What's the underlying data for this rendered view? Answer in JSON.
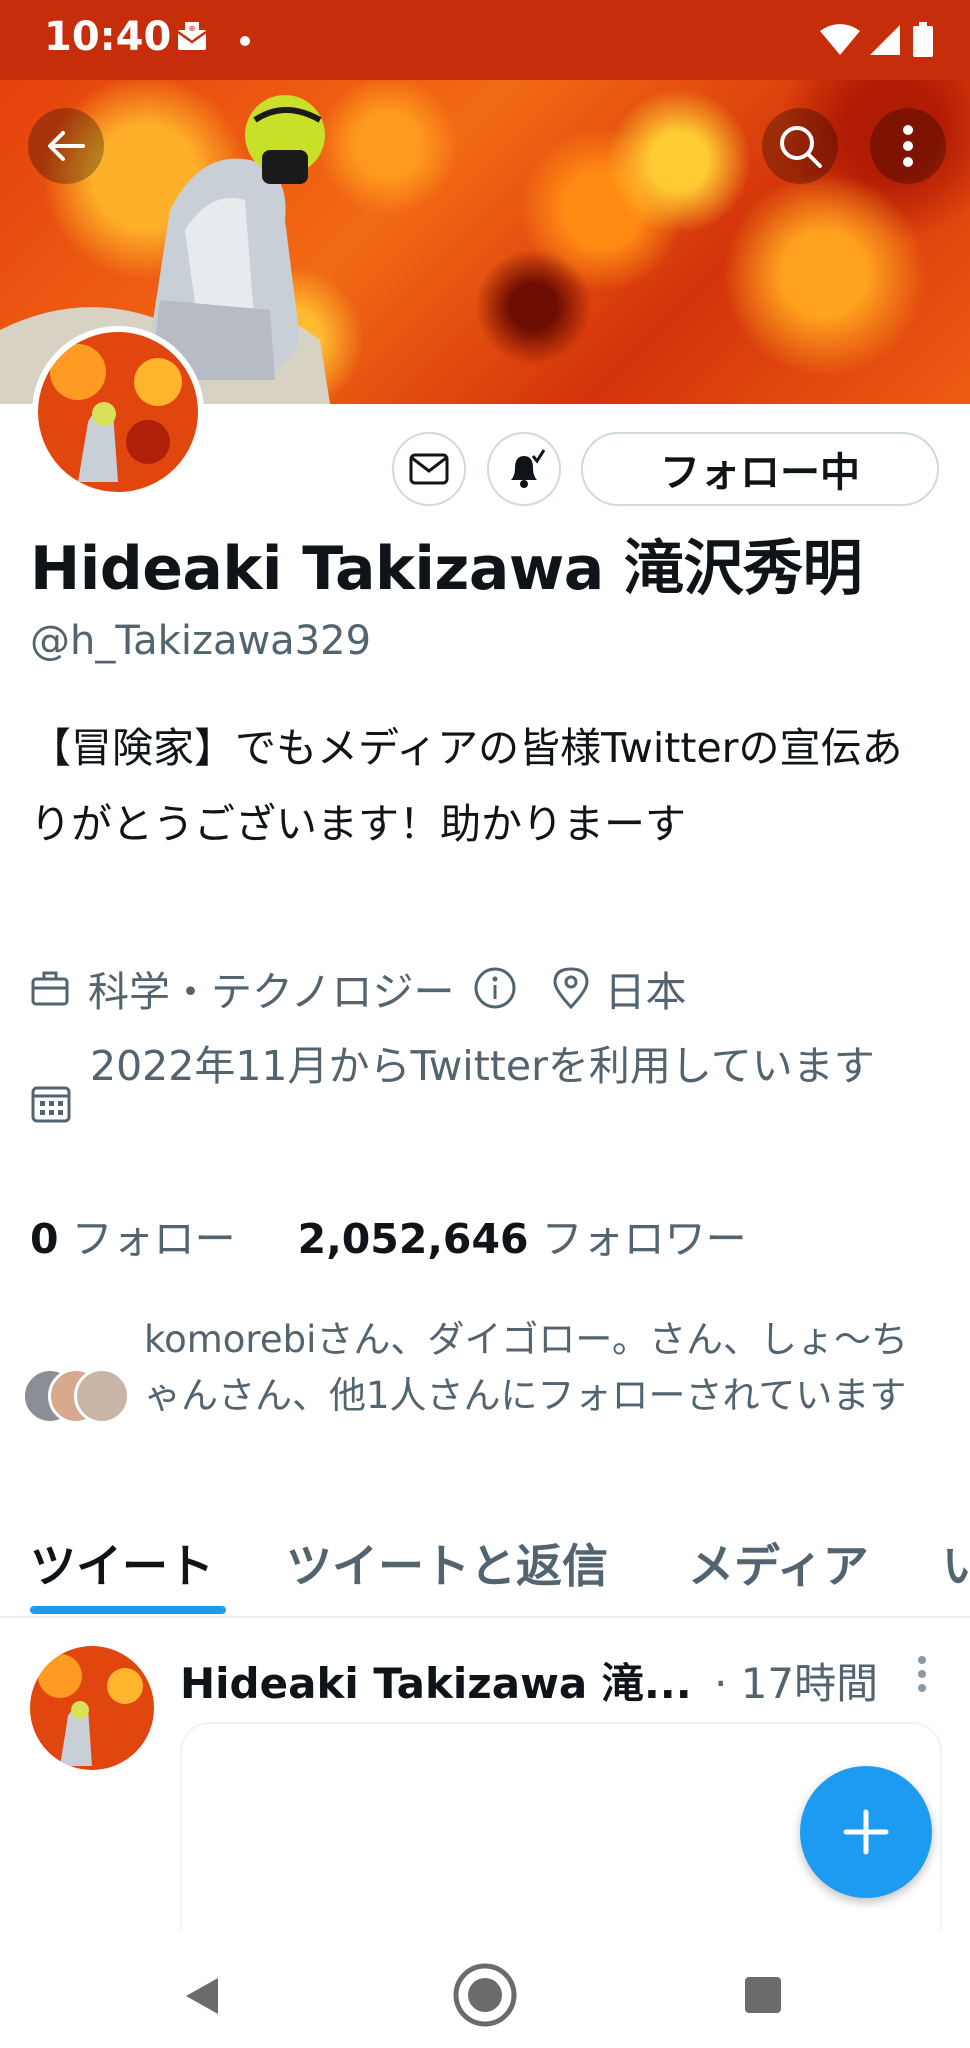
{
  "status_bar": {
    "time": "10:40"
  },
  "profile": {
    "name": "Hideaki Takizawa 滝沢秀明",
    "handle": "@h_Takizawa329",
    "bio": "【冒険家】でもメディアの皆様Twitterの宣伝ありがとうございます！助かりまーす",
    "category": "科学・テクノロジー",
    "location": "日本",
    "joined": "2022年11月からTwitterを利用しています",
    "following_count": "0",
    "following_label": "フォロー",
    "followers_count": "2,052,646",
    "followers_label": "フォロワー",
    "followed_by": "komorebiさん、ダイゴロー。さん、しょ〜ちゃんさん、他1人さんにフォローされています"
  },
  "actions": {
    "follow_state": "フォロー中"
  },
  "tabs": [
    {
      "label": "ツイート",
      "active": true
    },
    {
      "label": "ツイートと返信",
      "active": false
    },
    {
      "label": "メディア",
      "active": false
    },
    {
      "label": "い",
      "active": false
    }
  ],
  "tweet": {
    "author": "Hideaki Takizawa 滝...",
    "time": "· 17時間"
  },
  "colors": {
    "accent": "#1d9bf0",
    "status_bar": "#c62d0a",
    "secondary_text": "#536471"
  }
}
